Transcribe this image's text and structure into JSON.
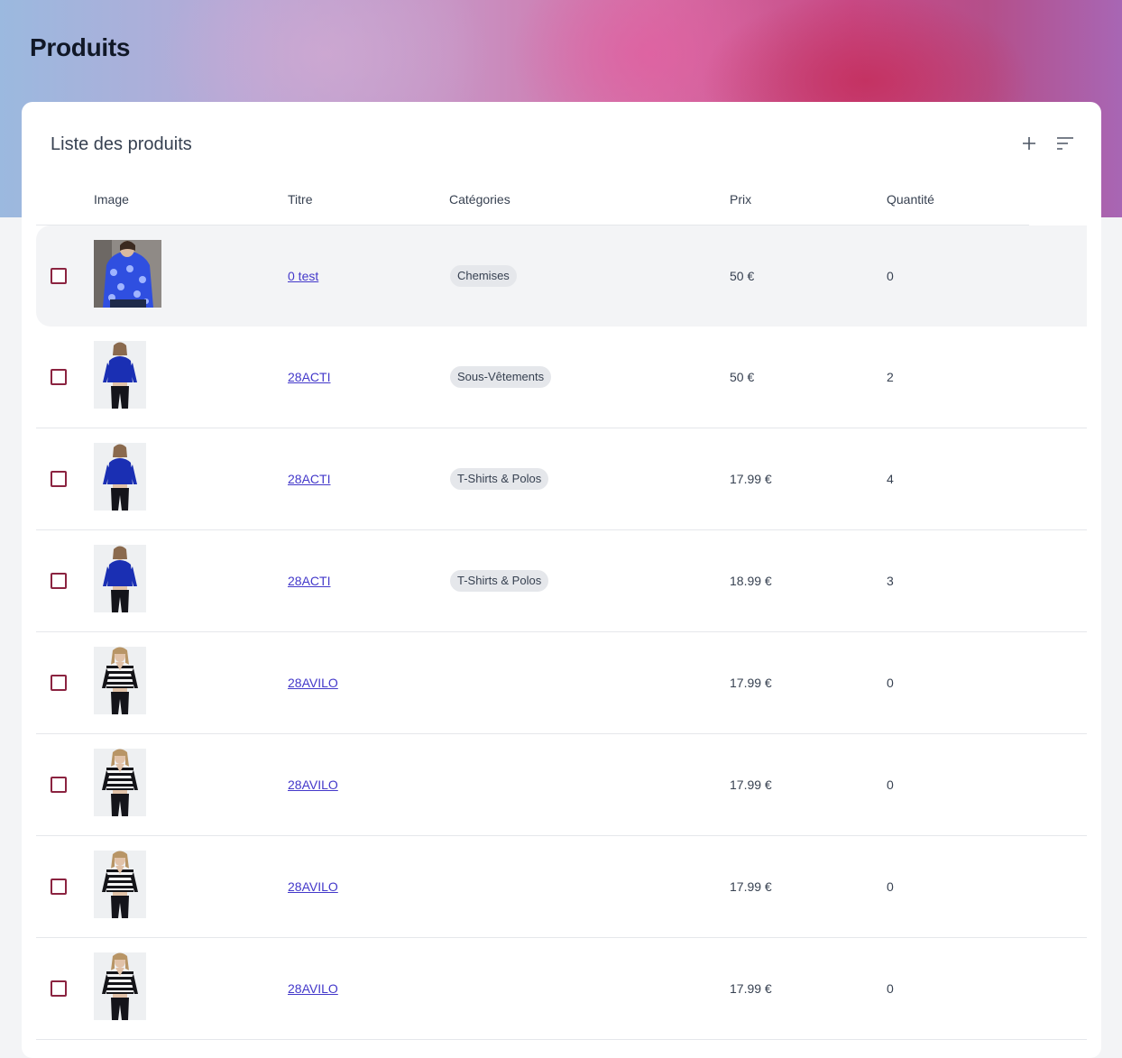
{
  "page": {
    "title": "Produits"
  },
  "card": {
    "title": "Liste des produits",
    "actions": [
      {
        "icon": "plus-icon"
      },
      {
        "icon": "sort-icon"
      }
    ]
  },
  "table": {
    "headers": {
      "image": "Image",
      "title": "Titre",
      "categories": "Catégories",
      "price": "Prix",
      "quantity": "Quantité"
    },
    "rows": [
      {
        "title": "0 test",
        "category": "Chemises",
        "price": "50 €",
        "quantity": "0",
        "image": "blue-heart-shirt"
      },
      {
        "title": "28ACTI",
        "category": "Sous-Vêtements",
        "price": "50 €",
        "quantity": "2",
        "image": "blue-crop-top"
      },
      {
        "title": "28ACTI",
        "category": "T-Shirts & Polos",
        "price": "17.99 €",
        "quantity": "4",
        "image": "blue-crop-top"
      },
      {
        "title": "28ACTI",
        "category": "T-Shirts & Polos",
        "price": "18.99 €",
        "quantity": "3",
        "image": "blue-crop-top"
      },
      {
        "title": "28AVILO",
        "category": "",
        "price": "17.99 €",
        "quantity": "0",
        "image": "striped-sweater"
      },
      {
        "title": "28AVILO",
        "category": "",
        "price": "17.99 €",
        "quantity": "0",
        "image": "striped-sweater"
      },
      {
        "title": "28AVILO",
        "category": "",
        "price": "17.99 €",
        "quantity": "0",
        "image": "striped-sweater"
      },
      {
        "title": "28AVILO",
        "category": "",
        "price": "17.99 €",
        "quantity": "0",
        "image": "striped-sweater"
      }
    ]
  },
  "colors": {
    "link": "#4338ca",
    "checkbox_border": "#8b2340",
    "chip_bg": "#e5e7eb"
  }
}
